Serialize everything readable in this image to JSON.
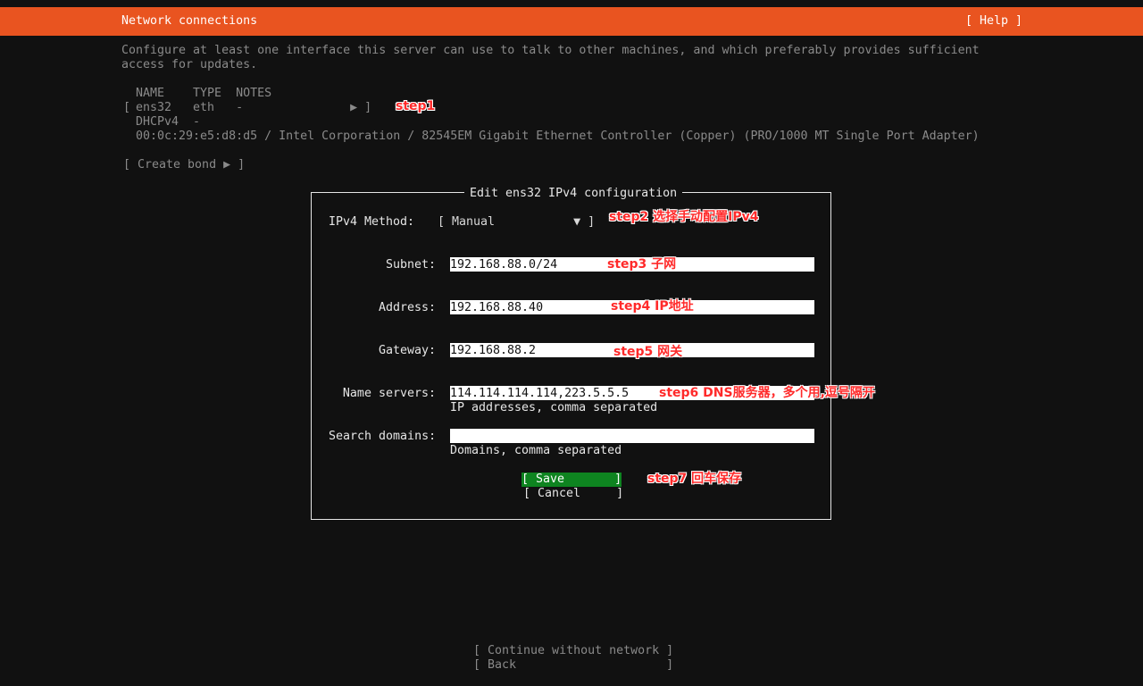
{
  "header": {
    "title": "Network connections",
    "help": "[ Help ]"
  },
  "intro": {
    "line1": "Configure at least one interface this server can use to talk to other machines, and which preferably provides sufficient",
    "line2": "access for updates."
  },
  "interfaces": {
    "columns": [
      "NAME",
      "TYPE",
      "NOTES"
    ],
    "header_row": "NAME    TYPE  NOTES",
    "row": {
      "open": "[",
      "text": "ens32   eth   -               ▶ ]"
    },
    "dhcp": "DHCPv4  -",
    "hw": "00:0c:29:e5:d8:d5 / Intel Corporation / 82545EM Gigabit Ethernet Controller (Copper) (PRO/1000 MT Single Port Adapter)"
  },
  "create_bond": "[ Create bond ▶ ]",
  "dialog": {
    "title": "Edit ens32 IPv4 configuration",
    "method_label": "IPv4 Method:",
    "method_value": "[ Manual           ▼ ]",
    "subnet_label": "Subnet:",
    "subnet_value": "192.168.88.0/24",
    "address_label": "Address:",
    "address_value": "192.168.88.40",
    "gateway_label": "Gateway:",
    "gateway_value": "192.168.88.2",
    "ns_label": "Name servers:",
    "ns_value": "114.114.114.114,223.5.5.5",
    "ns_hint": "IP addresses, comma separated",
    "sd_label": "Search domains:",
    "sd_value": "",
    "sd_hint": "Domains, comma separated",
    "save": "[ Save       ]",
    "cancel": "[ Cancel     ]"
  },
  "footer": {
    "continue": "[ Continue without network ]",
    "back": "[ Back                     ]"
  },
  "annotations": {
    "step1": "step1",
    "step2": "step2 选择手动配置IPv4",
    "step3": "step3 子网",
    "step4": "step4 IP地址",
    "step5": "step5 网关",
    "step6": "step6 DNS服务器，多个用,逗号隔开",
    "step7": "step7 回车保存"
  },
  "colors": {
    "header_bg": "#e95420",
    "save_bg": "#0e8420",
    "annotation": "#ff2a2a"
  }
}
